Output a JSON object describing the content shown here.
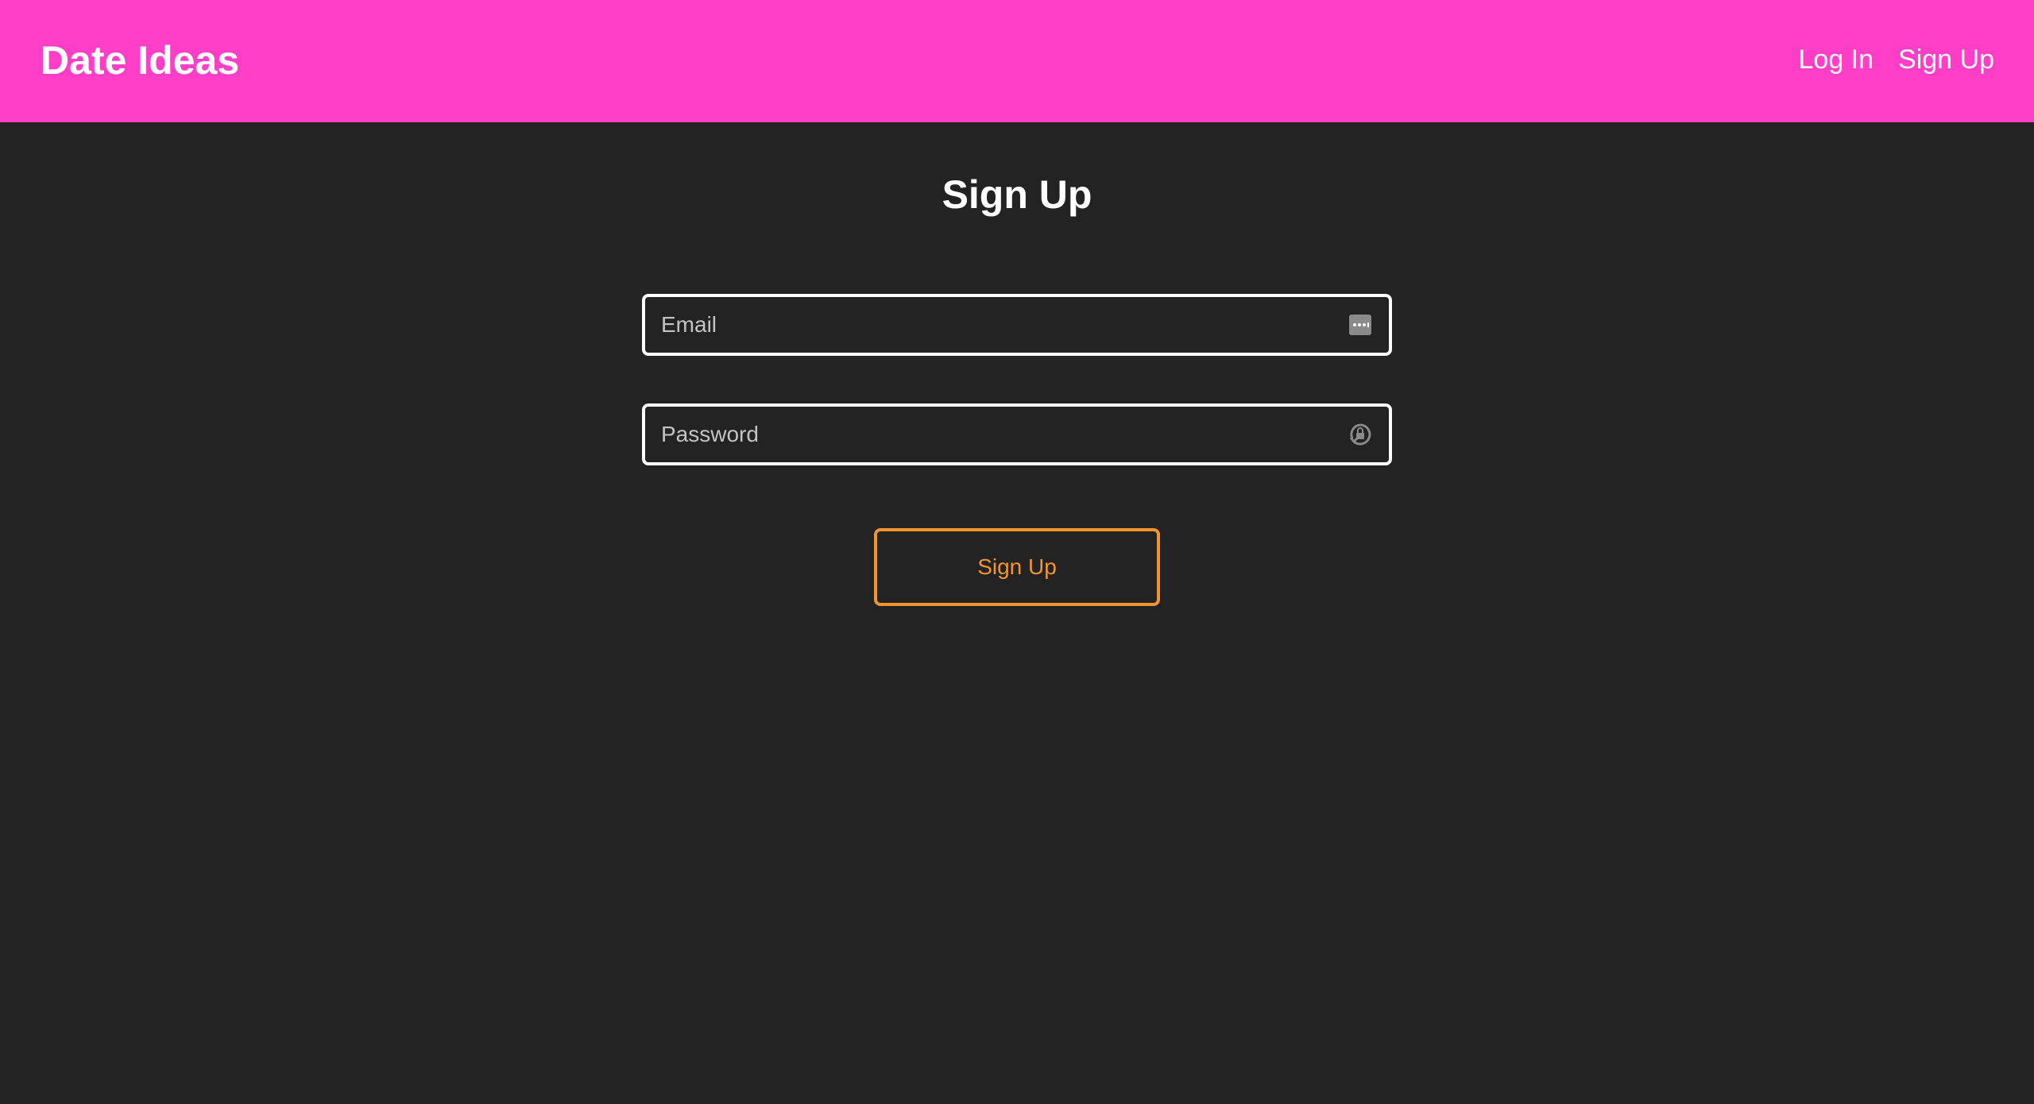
{
  "header": {
    "brand": "Date Ideas",
    "nav": {
      "login_label": "Log In",
      "signup_label": "Sign Up"
    },
    "background_color": "#ff3ec8"
  },
  "main": {
    "title": "Sign Up",
    "email_field": {
      "placeholder": "Email",
      "value": "",
      "icon": "autofill-card-icon"
    },
    "password_field": {
      "placeholder": "Password",
      "value": "",
      "icon": "password-key-icon"
    },
    "submit_label": "Sign Up",
    "accent_color": "#f2952e",
    "background_color": "#232323"
  }
}
